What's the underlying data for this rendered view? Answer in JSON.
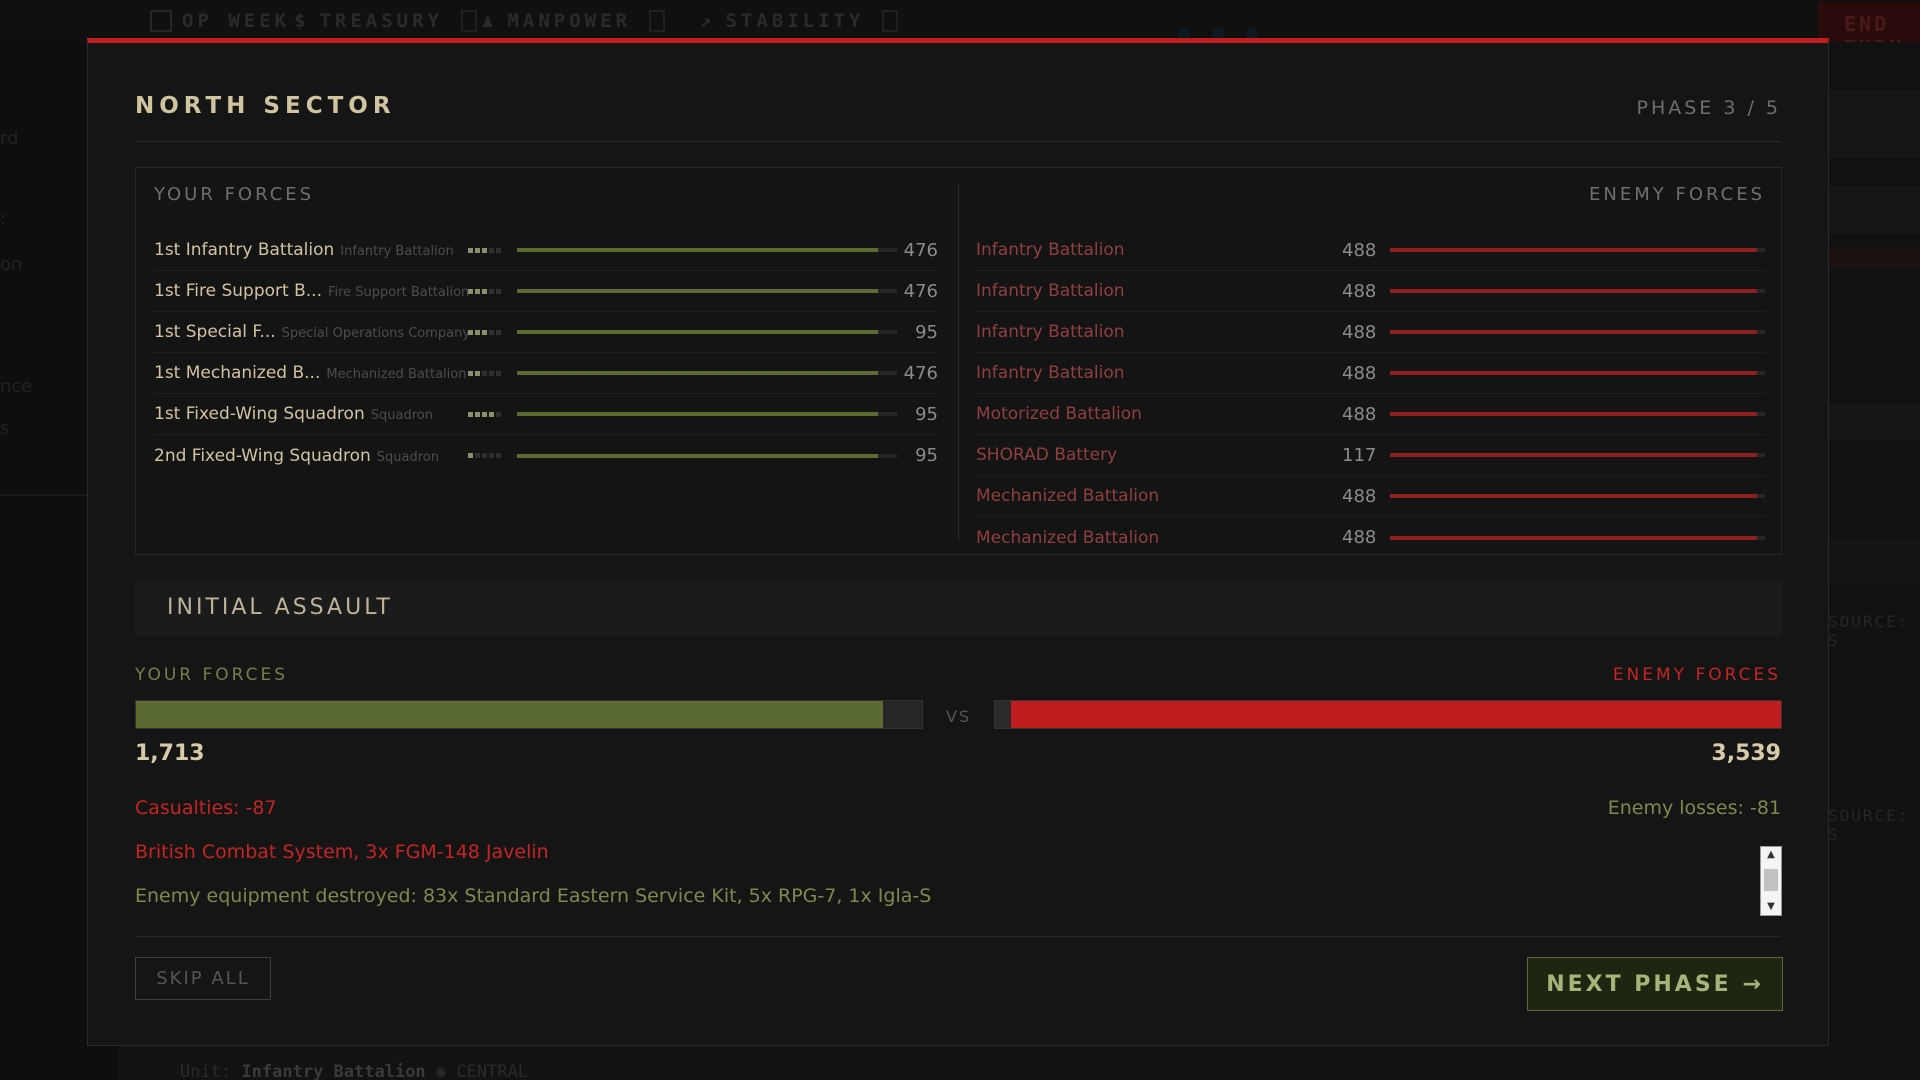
{
  "background": {
    "topbar": [
      {
        "label": "OP WEEK"
      },
      {
        "label": "TREASURY"
      },
      {
        "label": "MANPOWER"
      },
      {
        "label": "STABILITY"
      }
    ],
    "end_turn_label": "END TURN",
    "resource_label": "SOURCE",
    "bottom_key": "Unit:",
    "bottom_unit": "Infantry Battalion",
    "bottom_region": "CENTRAL"
  },
  "modal": {
    "title": "NORTH SECTOR",
    "phase": "PHASE 3 / 5",
    "your_forces_title": "YOUR FORCES",
    "enemy_forces_title": "ENEMY FORCES",
    "your_units": [
      {
        "name": "1st Infantry Battalion",
        "type": "Infantry Battalion",
        "value": "476",
        "pips": 3,
        "health": 0.95
      },
      {
        "name": "1st Fire Support B...",
        "type": "Fire Support Battalion",
        "value": "476",
        "pips": 3,
        "health": 0.95
      },
      {
        "name": "1st Special F...",
        "type": "Special Operations Company",
        "value": "95",
        "pips": 3,
        "health": 0.95
      },
      {
        "name": "1st Mechanized B...",
        "type": "Mechanized Battalion",
        "value": "476",
        "pips": 2,
        "health": 0.95
      },
      {
        "name": "1st Fixed-Wing Squadron",
        "type": "Squadron",
        "value": "95",
        "pips": 4,
        "health": 0.95
      },
      {
        "name": "2nd Fixed-Wing Squadron",
        "type": "Squadron",
        "value": "95",
        "pips": 1,
        "health": 0.95
      }
    ],
    "enemy_units": [
      {
        "name": "Infantry Battalion",
        "value": "488",
        "health": 0.98
      },
      {
        "name": "Infantry Battalion",
        "value": "488",
        "health": 0.98
      },
      {
        "name": "Infantry Battalion",
        "value": "488",
        "health": 0.98
      },
      {
        "name": "Infantry Battalion",
        "value": "488",
        "health": 0.98
      },
      {
        "name": "Motorized Battalion",
        "value": "488",
        "health": 0.98
      },
      {
        "name": "SHORAD Battery",
        "value": "117",
        "health": 0.98
      },
      {
        "name": "Mechanized Battalion",
        "value": "488",
        "health": 0.98
      },
      {
        "name": "Mechanized Battalion",
        "value": "488",
        "health": 0.98
      }
    ],
    "phase_name": "INITIAL ASSAULT",
    "comparison": {
      "your_label": "YOUR FORCES",
      "enemy_label": "ENEMY FORCES",
      "vs": "VS",
      "your_value": "1,713",
      "enemy_value": "3,539",
      "your_fill": 0.95,
      "enemy_fill": 0.98
    },
    "casualties": "Casualties: -87",
    "enemy_losses": "Enemy losses: -81",
    "log": [
      "British Combat System, 3x FGM-148 Javelin",
      "Enemy equipment destroyed: 83x Standard Eastern Service Kit, 5x RPG-7, 1x Igla-S"
    ],
    "skip_label": "SKIP ALL",
    "next_label": "NEXT PHASE →"
  },
  "colors": {
    "accent_red": "#c01e1e",
    "friendly_green": "#5a6a33",
    "title_gold": "#cfc3a0"
  },
  "icons": {
    "op_week": "calendar-icon",
    "treasury": "dollar-icon",
    "manpower": "person-icon",
    "stability": "chart-icon"
  }
}
